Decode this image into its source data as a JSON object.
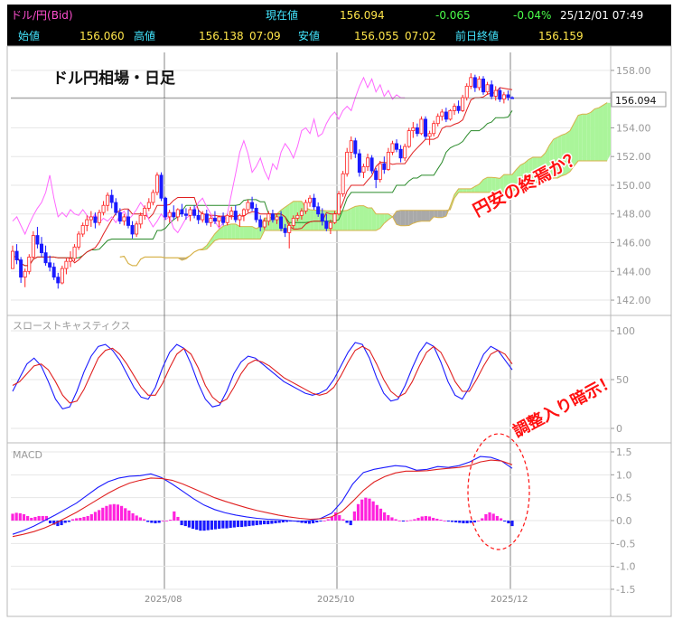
{
  "header": {
    "symbol": "ドル/円(Bid)",
    "current_label": "現在値",
    "current_value": "156.094",
    "change_value": "-0.065",
    "change_pct": "-0.04%",
    "datetime": "25/12/01  07:49",
    "open_label": "始値",
    "open_value": "156.060",
    "high_label": "高値",
    "high_value": "156.138",
    "high_time": "07:09",
    "low_label": "安値",
    "low_value": "156.055",
    "low_time": "07:02",
    "prev_close_label": "前日終値",
    "prev_close_value": "156.159"
  },
  "colors": {
    "up_candle": "#ff2222",
    "down_candle": "#1a1aff",
    "kijun": "#2a8a2a",
    "tenkan": "#e02020",
    "chikou": "#ff66ff",
    "cloud_bull": "#aaf59a",
    "cloud_bear": "#a9a9a9",
    "stoch_k": "#1a1aff",
    "stoch_d": "#e02020",
    "macd_line": "#1a1aff",
    "signal_line": "#e02020",
    "hist_pos": "#ff22dd",
    "hist_neg": "#1a1aff",
    "annotation": "#ff1111"
  },
  "chart_data": [
    {
      "type": "candlestick",
      "title": "ドル円相場・日足",
      "y_ticks": [
        "158.00",
        "156.00",
        "154.00",
        "152.00",
        "150.00",
        "148.00",
        "146.00",
        "144.00",
        "142.00"
      ],
      "ylim": [
        141.5,
        159
      ],
      "x_tick_labels": [
        "2025/08",
        "2025/10",
        "2025/12"
      ],
      "last_price_label": "156.094",
      "indicators": [
        "ichimoku_tenkan",
        "ichimoku_kijun",
        "ichimoku_chikou",
        "ichimoku_cloud"
      ],
      "annotation": "円安の終焉か？",
      "ohlc": [
        [
          144.2,
          145.8,
          144.2,
          145.4
        ],
        [
          145.4,
          145.9,
          144.5,
          144.8
        ],
        [
          144.8,
          145.0,
          143.2,
          143.6
        ],
        [
          143.6,
          144.2,
          142.9,
          144.0
        ],
        [
          144.0,
          145.2,
          143.8,
          145.0
        ],
        [
          145.0,
          146.8,
          144.9,
          146.5
        ],
        [
          146.5,
          147.1,
          145.6,
          145.9
        ],
        [
          145.9,
          146.4,
          145.0,
          145.3
        ],
        [
          145.3,
          145.8,
          144.4,
          144.6
        ],
        [
          144.6,
          145.1,
          144.0,
          144.3
        ],
        [
          144.3,
          144.6,
          143.4,
          143.6
        ],
        [
          143.6,
          143.9,
          142.8,
          143.2
        ],
        [
          143.2,
          144.4,
          143.1,
          144.2
        ],
        [
          144.2,
          144.9,
          143.8,
          144.7
        ],
        [
          144.7,
          145.4,
          144.3,
          144.9
        ],
        [
          144.9,
          145.9,
          144.7,
          145.7
        ],
        [
          145.7,
          146.8,
          145.5,
          146.6
        ],
        [
          146.6,
          147.4,
          146.4,
          147.2
        ],
        [
          147.2,
          147.9,
          146.8,
          147.6
        ],
        [
          147.6,
          148.2,
          147.1,
          147.8
        ],
        [
          147.8,
          148.1,
          147.0,
          147.4
        ],
        [
          147.4,
          148.3,
          147.2,
          148.1
        ],
        [
          148.1,
          148.9,
          147.9,
          148.6
        ],
        [
          148.6,
          149.5,
          148.2,
          149.3
        ],
        [
          149.3,
          149.7,
          148.4,
          148.8
        ],
        [
          148.8,
          149.1,
          147.9,
          148.1
        ],
        [
          148.1,
          148.4,
          147.3,
          147.5
        ],
        [
          147.5,
          148.0,
          147.2,
          147.8
        ],
        [
          147.8,
          148.3,
          147.0,
          147.2
        ],
        [
          147.2,
          147.5,
          146.3,
          146.6
        ],
        [
          146.6,
          147.5,
          146.4,
          147.3
        ],
        [
          147.3,
          148.1,
          147.0,
          147.9
        ],
        [
          147.9,
          148.6,
          147.6,
          148.4
        ],
        [
          148.4,
          149.1,
          148.2,
          148.8
        ],
        [
          148.8,
          149.7,
          148.6,
          149.5
        ],
        [
          149.5,
          150.9,
          149.3,
          150.7
        ],
        [
          150.7,
          150.9,
          148.9,
          149.1
        ],
        [
          149.1,
          149.2,
          147.6,
          147.8
        ],
        [
          147.8,
          148.3,
          147.4,
          148.1
        ],
        [
          148.1,
          148.6,
          147.6,
          147.8
        ],
        [
          147.8,
          148.4,
          147.5,
          148.3
        ],
        [
          148.3,
          148.7,
          147.8,
          148.0
        ],
        [
          148.0,
          148.4,
          147.6,
          147.9
        ],
        [
          147.9,
          148.5,
          147.5,
          148.3
        ],
        [
          148.3,
          148.6,
          147.7,
          147.9
        ],
        [
          147.9,
          148.3,
          147.3,
          147.6
        ],
        [
          147.6,
          148.2,
          147.4,
          148.0
        ],
        [
          148.0,
          148.3,
          147.2,
          147.4
        ],
        [
          147.4,
          147.9,
          147.1,
          147.7
        ],
        [
          147.7,
          148.2,
          147.3,
          147.5
        ],
        [
          147.5,
          147.9,
          147.1,
          147.8
        ],
        [
          147.8,
          148.1,
          147.2,
          147.4
        ],
        [
          147.4,
          148.0,
          147.2,
          147.9
        ],
        [
          147.9,
          148.5,
          147.6,
          148.2
        ],
        [
          148.2,
          148.6,
          147.4,
          147.6
        ],
        [
          147.6,
          148.0,
          147.1,
          147.9
        ],
        [
          147.9,
          148.4,
          147.5,
          148.3
        ],
        [
          148.3,
          149.0,
          148.1,
          148.8
        ],
        [
          148.8,
          149.2,
          148.2,
          148.4
        ],
        [
          148.4,
          148.7,
          147.4,
          147.6
        ],
        [
          147.6,
          147.9,
          146.8,
          147.1
        ],
        [
          147.1,
          147.7,
          146.9,
          147.5
        ],
        [
          147.5,
          148.2,
          147.2,
          148.0
        ],
        [
          148.0,
          148.3,
          147.4,
          147.6
        ],
        [
          147.6,
          148.0,
          147.3,
          147.8
        ],
        [
          147.8,
          148.2,
          146.8,
          147.0
        ],
        [
          147.0,
          147.3,
          146.4,
          146.7
        ],
        [
          146.7,
          147.4,
          145.6,
          147.2
        ],
        [
          147.2,
          147.9,
          147.0,
          147.7
        ],
        [
          147.7,
          148.1,
          147.5,
          147.9
        ],
        [
          147.9,
          148.4,
          147.6,
          148.2
        ],
        [
          148.2,
          149.0,
          148.0,
          148.8
        ],
        [
          148.8,
          149.3,
          148.5,
          149.1
        ],
        [
          149.1,
          149.4,
          148.3,
          148.5
        ],
        [
          148.5,
          148.8,
          147.8,
          148.0
        ],
        [
          148.0,
          148.4,
          147.2,
          147.5
        ],
        [
          147.5,
          148.0,
          146.8,
          147.0
        ],
        [
          147.0,
          147.6,
          146.6,
          147.4
        ],
        [
          147.4,
          148.2,
          147.3,
          148.0
        ],
        [
          148.0,
          149.6,
          147.9,
          149.4
        ],
        [
          149.4,
          151.0,
          149.2,
          150.8
        ],
        [
          150.8,
          152.6,
          150.6,
          152.3
        ],
        [
          152.3,
          153.4,
          151.8,
          153.1
        ],
        [
          153.1,
          153.3,
          151.9,
          152.2
        ],
        [
          152.2,
          152.5,
          150.6,
          150.9
        ],
        [
          150.9,
          151.5,
          150.5,
          151.3
        ],
        [
          151.3,
          152.2,
          151.0,
          151.9
        ],
        [
          151.9,
          152.1,
          150.8,
          151.0
        ],
        [
          151.0,
          151.2,
          149.8,
          150.4
        ],
        [
          150.4,
          151.7,
          150.2,
          151.5
        ],
        [
          151.5,
          152.0,
          150.8,
          151.1
        ],
        [
          151.1,
          152.6,
          151.0,
          152.3
        ],
        [
          152.3,
          153.1,
          152.1,
          152.9
        ],
        [
          152.9,
          153.2,
          152.3,
          152.5
        ],
        [
          152.5,
          152.8,
          151.6,
          151.9
        ],
        [
          151.9,
          152.9,
          151.7,
          152.7
        ],
        [
          152.7,
          154.0,
          152.6,
          153.8
        ],
        [
          153.8,
          154.4,
          153.3,
          154.0
        ],
        [
          154.0,
          154.3,
          153.4,
          153.6
        ],
        [
          153.6,
          154.8,
          153.5,
          154.6
        ],
        [
          154.6,
          154.8,
          153.2,
          153.4
        ],
        [
          153.4,
          153.8,
          152.8,
          153.6
        ],
        [
          153.6,
          154.5,
          153.4,
          154.3
        ],
        [
          154.3,
          155.0,
          154.1,
          154.8
        ],
        [
          154.8,
          155.3,
          154.5,
          155.1
        ],
        [
          155.1,
          155.4,
          154.4,
          154.6
        ],
        [
          154.6,
          155.3,
          154.5,
          155.2
        ],
        [
          155.2,
          155.7,
          154.9,
          155.5
        ],
        [
          155.5,
          155.9,
          155.0,
          155.2
        ],
        [
          155.2,
          156.3,
          155.1,
          156.1
        ],
        [
          156.1,
          157.1,
          155.9,
          156.9
        ],
        [
          156.9,
          157.8,
          156.7,
          157.5
        ],
        [
          157.5,
          157.7,
          156.5,
          156.8
        ],
        [
          156.8,
          157.6,
          156.6,
          157.4
        ],
        [
          157.4,
          157.6,
          156.3,
          156.5
        ],
        [
          156.5,
          157.2,
          156.3,
          157.0
        ],
        [
          157.0,
          157.3,
          156.0,
          156.2
        ],
        [
          156.2,
          156.9,
          155.9,
          156.6
        ],
        [
          156.6,
          156.8,
          155.8,
          156.0
        ],
        [
          156.0,
          156.5,
          155.7,
          156.3
        ],
        [
          156.3,
          156.6,
          155.9,
          156.1
        ],
        [
          156.1,
          156.2,
          156.05,
          156.094
        ]
      ]
    },
    {
      "type": "line",
      "title": "スローストキャスティクス",
      "y_ticks": [
        "100",
        "50",
        "0"
      ],
      "ylim": [
        0,
        100
      ],
      "series": [
        {
          "values": [
            38,
            52,
            66,
            72,
            64,
            48,
            30,
            20,
            22,
            38,
            58,
            74,
            84,
            86,
            80,
            70,
            56,
            42,
            32,
            30,
            42,
            62,
            78,
            86,
            82,
            66,
            46,
            30,
            22,
            24,
            38,
            56,
            68,
            74,
            72,
            66,
            60,
            54,
            48,
            44,
            40,
            36,
            34,
            36,
            40,
            50,
            64,
            78,
            88,
            86,
            72,
            52,
            36,
            28,
            30,
            44,
            62,
            78,
            88,
            84,
            68,
            48,
            34,
            30,
            42,
            60,
            76,
            84,
            80,
            70,
            60
          ]
        },
        {
          "values": [
            44,
            48,
            56,
            64,
            66,
            60,
            48,
            34,
            26,
            28,
            40,
            56,
            72,
            80,
            82,
            76,
            66,
            54,
            42,
            34,
            34,
            46,
            62,
            76,
            82,
            76,
            62,
            44,
            32,
            26,
            30,
            42,
            56,
            66,
            70,
            68,
            64,
            58,
            52,
            48,
            44,
            40,
            36,
            34,
            36,
            42,
            54,
            68,
            80,
            84,
            80,
            66,
            50,
            38,
            32,
            36,
            48,
            64,
            78,
            84,
            78,
            64,
            48,
            38,
            38,
            50,
            64,
            76,
            80,
            76,
            66
          ]
        }
      ]
    },
    {
      "type": "bar",
      "title": "MACD",
      "y_ticks": [
        "1.5",
        "1.0",
        "0.5",
        "0.0",
        "-0.5",
        "-1.0",
        "-1.5"
      ],
      "ylim": [
        -1.5,
        1.5
      ],
      "annotation": "調整入り暗示！",
      "series": [
        {
          "values": [
            -0.3,
            -0.22,
            -0.12,
            0.0,
            0.12,
            0.25,
            0.38,
            0.55,
            0.72,
            0.85,
            0.93,
            0.97,
            0.98,
            1.02,
            0.94,
            0.8,
            0.64,
            0.48,
            0.34,
            0.24,
            0.17,
            0.12,
            0.08,
            0.05,
            0.03,
            0.02,
            0.0,
            -0.02,
            0.0,
            0.05,
            0.16,
            0.42,
            0.8,
            1.05,
            1.12,
            1.16,
            1.2,
            1.18,
            1.1,
            1.12,
            1.18,
            1.16,
            1.2,
            1.28,
            1.4,
            1.38,
            1.3,
            1.14
          ]
        },
        {
          "values": [
            -0.35,
            -0.3,
            -0.24,
            -0.16,
            -0.06,
            0.06,
            0.18,
            0.32,
            0.46,
            0.6,
            0.72,
            0.82,
            0.88,
            0.93,
            0.92,
            0.88,
            0.8,
            0.7,
            0.6,
            0.5,
            0.42,
            0.35,
            0.28,
            0.22,
            0.17,
            0.12,
            0.08,
            0.05,
            0.03,
            0.04,
            0.08,
            0.2,
            0.42,
            0.66,
            0.84,
            0.96,
            1.04,
            1.08,
            1.08,
            1.09,
            1.12,
            1.14,
            1.16,
            1.2,
            1.28,
            1.32,
            1.3,
            1.22
          ]
        }
      ],
      "histogram": [
        0.15,
        0.17,
        0.16,
        0.14,
        0.1,
        0.06,
        0.08,
        0.1,
        0.1,
        0.1,
        -0.06,
        -0.09,
        -0.12,
        -0.1,
        -0.05,
        -0.03,
        0.03,
        0.05,
        0.06,
        0.08,
        0.1,
        0.14,
        0.19,
        0.23,
        0.28,
        0.32,
        0.35,
        0.36,
        0.35,
        0.32,
        0.27,
        0.22,
        0.16,
        0.11,
        0.07,
        0.03,
        -0.03,
        -0.05,
        -0.06,
        -0.05,
        0.0,
        0.0,
        0.02,
        0.2,
        0.08,
        -0.1,
        -0.12,
        -0.15,
        -0.18,
        -0.2,
        -0.22,
        -0.22,
        -0.21,
        -0.2,
        -0.19,
        -0.18,
        -0.17,
        -0.17,
        -0.16,
        -0.15,
        -0.14,
        -0.14,
        -0.13,
        -0.12,
        -0.11,
        -0.1,
        -0.09,
        -0.08,
        -0.08,
        -0.07,
        -0.06,
        -0.05,
        -0.04,
        -0.03,
        -0.02,
        -0.01,
        -0.03,
        -0.05,
        -0.06,
        -0.07,
        -0.06,
        -0.04,
        -0.02,
        0.0,
        0.03,
        0.08,
        0.18,
        0.12,
        0.03,
        -0.05,
        -0.1,
        0.2,
        0.36,
        0.46,
        0.5,
        0.48,
        0.42,
        0.34,
        0.26,
        0.18,
        0.12,
        0.07,
        0.03,
        0.0,
        -0.02,
        0.0,
        0.01,
        0.03,
        0.06,
        0.09,
        0.1,
        0.09,
        0.06,
        0.04,
        0.02,
        0.0,
        -0.02,
        -0.03,
        -0.04,
        -0.05,
        -0.06,
        -0.06,
        -0.05,
        -0.04,
        0.0,
        0.05,
        0.14,
        0.18,
        0.15,
        0.1,
        0.05,
        -0.02,
        -0.06,
        -0.12
      ]
    }
  ]
}
